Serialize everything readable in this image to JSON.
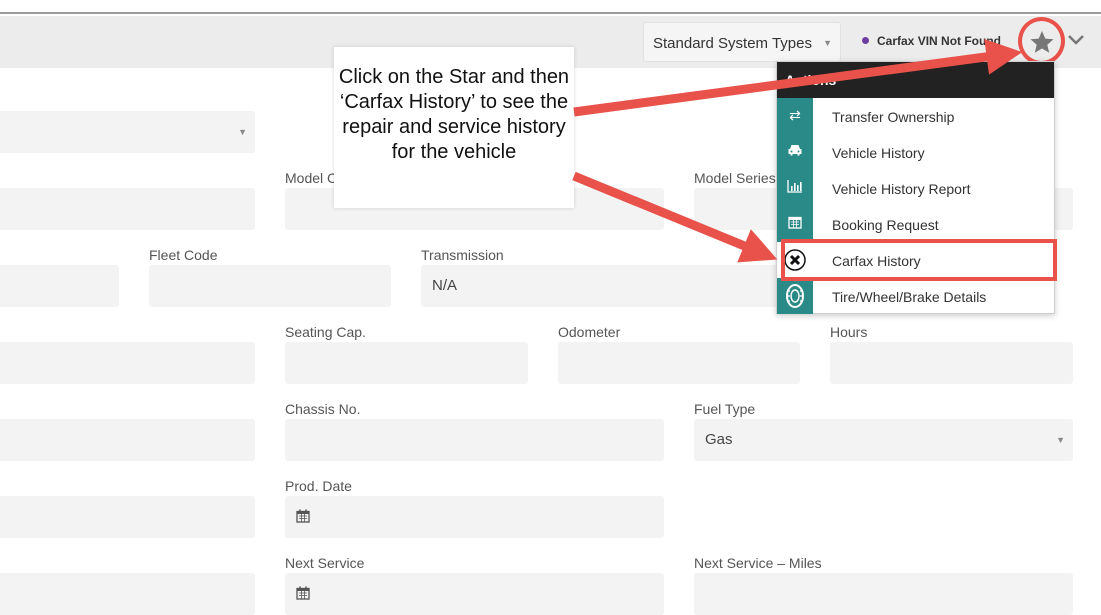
{
  "toolbar": {
    "system_types_select": "Standard System Types",
    "carfax_status": "Carfax VIN Not Found",
    "star_icon": "star-icon",
    "chevron_icon": "chevron-down-icon"
  },
  "callout": {
    "text": "Click on the Star and then ‘Carfax History’ to see the repair and service history for the vehicle"
  },
  "actions_menu": {
    "title": "Actions",
    "items": [
      {
        "label": "Transfer Ownership",
        "icon": "transfer-icon"
      },
      {
        "label": "Vehicle History",
        "icon": "car-icon"
      },
      {
        "label": "Vehicle History Report",
        "icon": "bar-chart-icon"
      },
      {
        "label": "Booking Request",
        "icon": "calendar-icon"
      },
      {
        "label": "Carfax History",
        "icon": "carfax-icon"
      },
      {
        "label": "Tire/Wheel/Brake Details",
        "icon": "tire-icon"
      }
    ]
  },
  "form": {
    "model_code_label": "Model C",
    "model_series_label": "Model Series",
    "fleet_code_label": "Fleet Code",
    "transmission_label": "Transmission",
    "transmission_value": "N/A",
    "seating_cap_label": "Seating Cap.",
    "odometer_label": "Odometer",
    "hours_label": "Hours",
    "chassis_no_label": "Chassis No.",
    "fuel_type_label": "Fuel Type",
    "fuel_type_value": "Gas",
    "prod_date_label": "Prod. Date",
    "next_service_label": "Next Service",
    "next_service_miles_label": "Next Service – Miles"
  },
  "colors": {
    "menu_icon_bg": "#2a8a88",
    "highlight": "#e8524a",
    "status_dot": "#6b3fa0"
  }
}
